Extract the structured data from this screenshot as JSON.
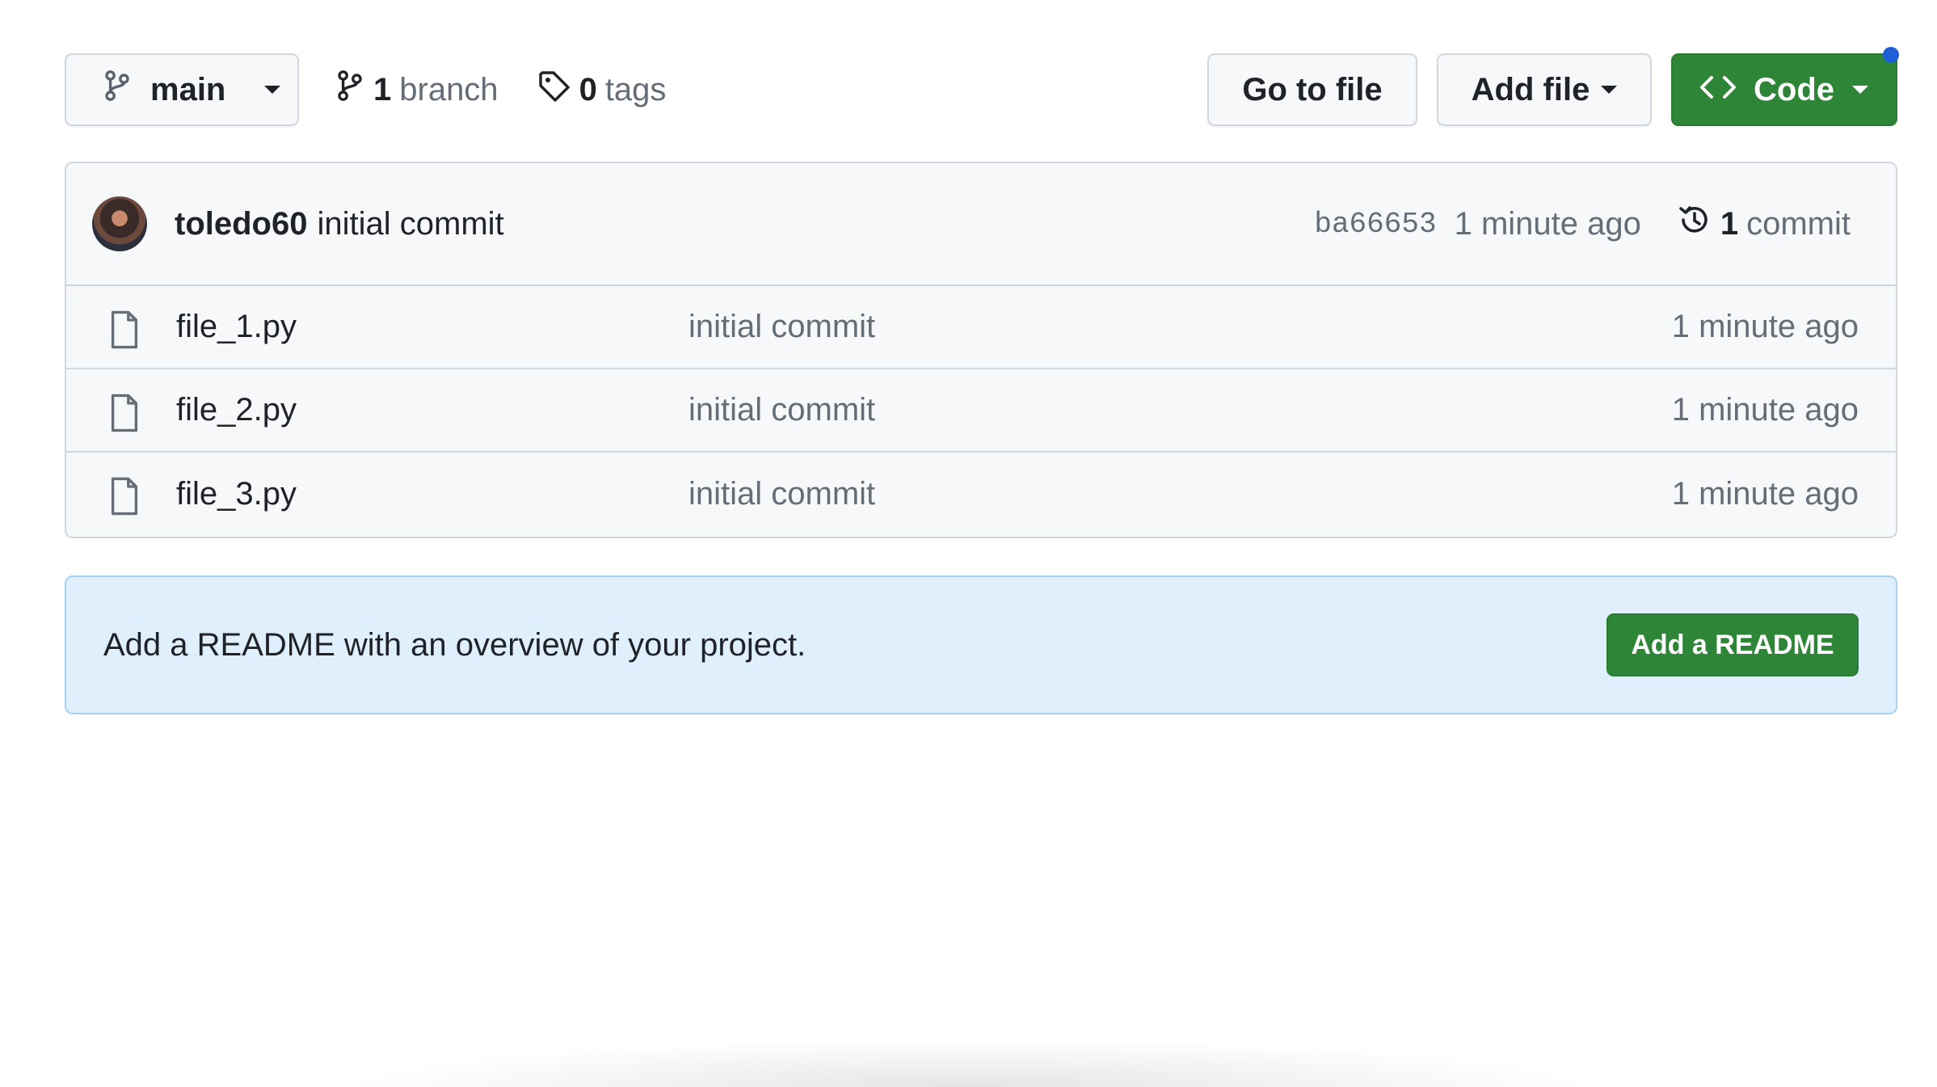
{
  "toolbar": {
    "branch_button_label": "main",
    "branches_count": "1",
    "branches_label": "branch",
    "tags_count": "0",
    "tags_label": "tags",
    "goto_file_label": "Go to file",
    "add_file_label": "Add file",
    "code_label": "Code"
  },
  "commit": {
    "author": "toledo60",
    "message": "initial commit",
    "sha": "ba66653",
    "time": "1 minute ago",
    "count": "1",
    "count_label": "commit"
  },
  "files": [
    {
      "name": "file_1.py",
      "commit_message": "initial commit",
      "time": "1 minute ago"
    },
    {
      "name": "file_2.py",
      "commit_message": "initial commit",
      "time": "1 minute ago"
    },
    {
      "name": "file_3.py",
      "commit_message": "initial commit",
      "time": "1 minute ago"
    }
  ],
  "readme": {
    "prompt": "Add a README with an overview of your project.",
    "button_label": "Add a README"
  },
  "colors": {
    "primary_green": "#2f8537",
    "notification_blue": "#1f5fd6",
    "banner_bg": "#dff0fc"
  },
  "icons": [
    "git-branch-icon",
    "tag-icon",
    "code-icon",
    "history-icon",
    "file-icon"
  ]
}
